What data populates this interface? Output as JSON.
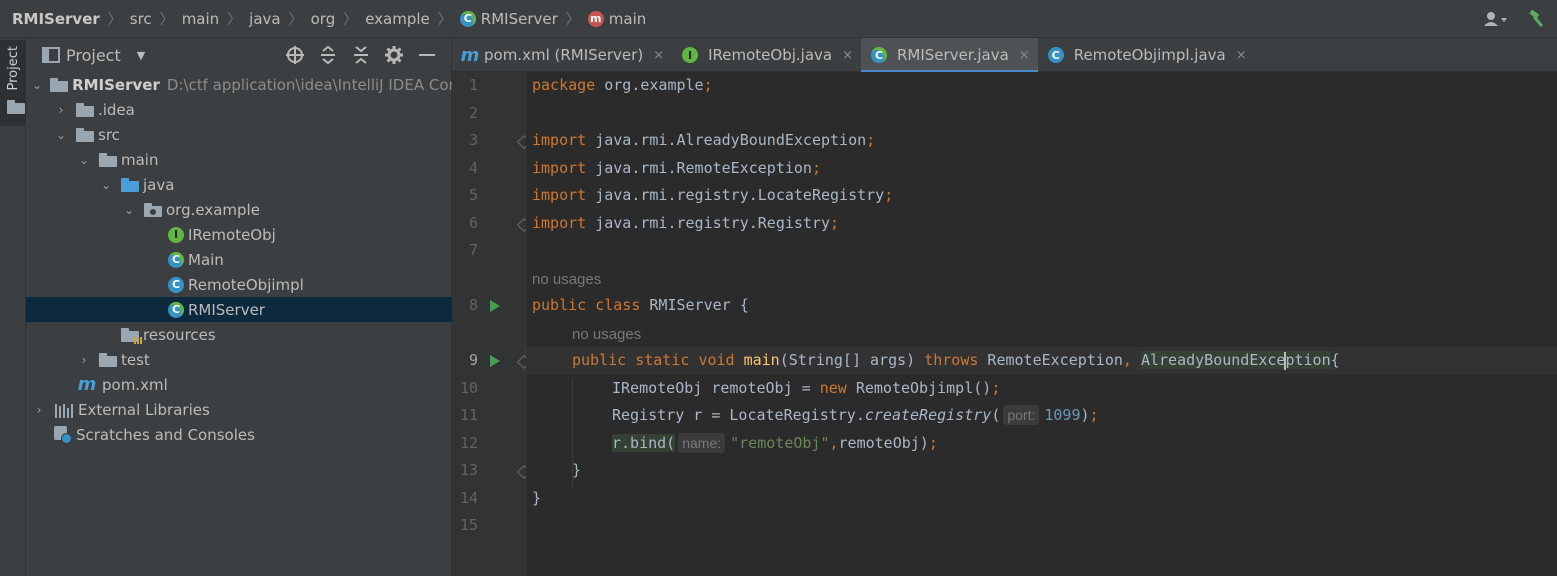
{
  "breadcrumb": [
    {
      "label": "RMIServer",
      "bold": true,
      "icon": ""
    },
    {
      "label": "src",
      "icon": ""
    },
    {
      "label": "main",
      "icon": ""
    },
    {
      "label": "java",
      "icon": ""
    },
    {
      "label": "org",
      "icon": ""
    },
    {
      "label": "example",
      "icon": ""
    },
    {
      "label": "RMIServer",
      "icon": "class-icon"
    },
    {
      "label": "main",
      "icon": "method-icon"
    }
  ],
  "class_icon_letter": "C",
  "interface_icon_letter": "I",
  "method_icon_letter": "m",
  "toolstrip": {
    "project_label": "Project"
  },
  "project_panel": {
    "title": "Project",
    "tree": [
      {
        "label": "RMIServer",
        "path": "D:\\ctf application\\idea\\IntelliJ IDEA Com",
        "bold": true,
        "icon": "module-folder",
        "arrow": "down",
        "depth": 0
      },
      {
        "label": ".idea",
        "icon": "folder",
        "arrow": "right",
        "depth": 1
      },
      {
        "label": "src",
        "icon": "folder",
        "arrow": "down",
        "depth": 1
      },
      {
        "label": "main",
        "icon": "folder",
        "arrow": "down",
        "depth": 2
      },
      {
        "label": "java",
        "icon": "source-folder",
        "arrow": "down",
        "depth": 3
      },
      {
        "label": "org.example",
        "icon": "package",
        "arrow": "down",
        "depth": 4
      },
      {
        "label": "IRemoteObj",
        "icon": "interface",
        "arrow": "none",
        "depth": 5
      },
      {
        "label": "Main",
        "icon": "runnable-class",
        "arrow": "none",
        "depth": 5
      },
      {
        "label": "RemoteObjimpl",
        "icon": "class",
        "arrow": "none",
        "depth": 5
      },
      {
        "label": "RMIServer",
        "icon": "runnable-class",
        "arrow": "none",
        "depth": 5,
        "selected": true
      },
      {
        "label": "resources",
        "icon": "resources-folder",
        "arrow": "none",
        "depth": 3
      },
      {
        "label": "test",
        "icon": "folder",
        "arrow": "right",
        "depth": 2
      },
      {
        "label": "pom.xml",
        "icon": "maven",
        "arrow": "none",
        "depth": 2
      },
      {
        "label": "External Libraries",
        "icon": "libraries",
        "arrow": "right",
        "depth": 0
      },
      {
        "label": "Scratches and Consoles",
        "icon": "scratches",
        "arrow": "none",
        "depth": 0
      }
    ]
  },
  "tabs": [
    {
      "label": "pom.xml (RMIServer)",
      "icon": "maven",
      "active": false
    },
    {
      "label": "IRemoteObj.java",
      "icon": "interface",
      "active": false
    },
    {
      "label": "RMIServer.java",
      "icon": "runnable-class",
      "active": true
    },
    {
      "label": "RemoteObjimpl.java",
      "icon": "class",
      "active": false
    }
  ],
  "maven_icon_letter": "m",
  "tab_close_glyph": "×",
  "editor": {
    "line_numbers": [
      "1",
      "2",
      "3",
      "4",
      "5",
      "6",
      "7",
      "8",
      "9",
      "10",
      "11",
      "12",
      "13",
      "14",
      "15"
    ],
    "usages_label": "no usages",
    "code": {
      "l1": {
        "kw": "package",
        "rest": " org.example",
        "semi": ";"
      },
      "l3": {
        "kw": "import",
        "rest": " java.rmi.AlreadyBoundException",
        "semi": ";"
      },
      "l4": {
        "kw": "import",
        "rest": " java.rmi.RemoteException",
        "semi": ";"
      },
      "l5": {
        "kw": "import",
        "rest": " java.rmi.registry.LocateRegistry",
        "semi": ";"
      },
      "l6": {
        "kw": "import",
        "rest": " java.rmi.registry.Registry",
        "semi": ";"
      },
      "l8": {
        "kw1": "public",
        "kw2": "class",
        "name": " RMIServer {"
      },
      "l9": {
        "kw1": "public",
        "kw2": "static",
        "kw3": "void",
        "fn": "main",
        "params": "(String[] args) ",
        "throws": "throws",
        "ex1": " RemoteException",
        "comma": ",",
        "ex2a": "AlreadyBoundExce",
        "ex2b": "ption",
        "brace": "{"
      },
      "l10": {
        "a": "IRemoteObj remoteObj = ",
        "kw": "new",
        "b": " RemoteObjimpl()",
        "semi": ";"
      },
      "l11": {
        "a": "Registry r = LocateRegistry.",
        "call": "createRegistry",
        "paren": "(",
        "hint": "port:",
        "num": "1099",
        "close": ")",
        "semi": ";"
      },
      "l12": {
        "a": "r.bind(",
        "hint": "name:",
        "str": "\"remoteObj\"",
        "comma": ",",
        "b": "remoteObj)",
        "semi": ";"
      },
      "l13": {
        "a": "}"
      },
      "l14": {
        "a": "}"
      }
    }
  }
}
